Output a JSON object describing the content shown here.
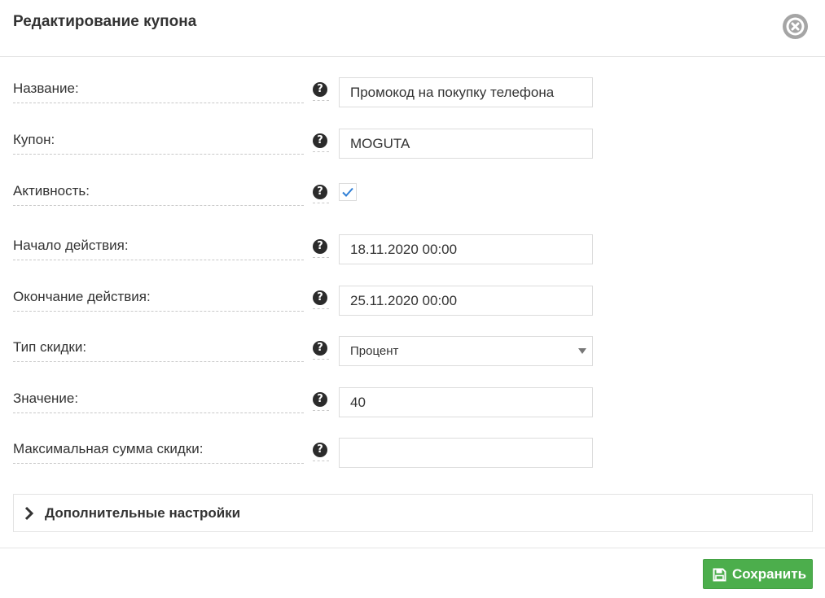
{
  "header": {
    "title": "Редактирование купона"
  },
  "form": {
    "name": {
      "label": "Название:",
      "value": "Промокод на покупку телефона"
    },
    "coupon": {
      "label": "Купон:",
      "value": "MOGUTA"
    },
    "active": {
      "label": "Активность:",
      "checked": true
    },
    "start": {
      "label": "Начало действия:",
      "value": "18.11.2020 00:00"
    },
    "end": {
      "label": "Окончание действия:",
      "value": "25.11.2020 00:00"
    },
    "discount_type": {
      "label": "Тип скидки:",
      "selected": "Процент"
    },
    "value": {
      "label": "Значение:",
      "value": "40"
    },
    "max_sum": {
      "label": "Максимальная сумма скидки:",
      "value": ""
    },
    "help_glyph": "?"
  },
  "advanced": {
    "label": "Дополнительные настройки"
  },
  "footer": {
    "save_label": "Сохранить"
  },
  "colors": {
    "save_button": "#4cae4c",
    "close_icon": "#a5a5a5",
    "checkmark": "#2f7fd6"
  }
}
